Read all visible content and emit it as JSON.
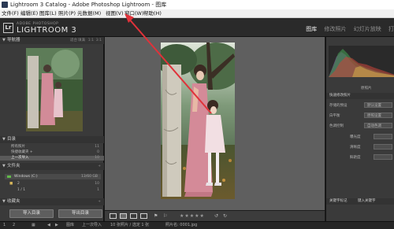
{
  "window": {
    "title": "Lightroom 3 Catalog - Adobe Photoshop Lightroom - 图库"
  },
  "menu": {
    "items": [
      "文件(F)",
      "编辑(E)",
      "图库(L)",
      "照片(P)",
      "元数据(M)",
      "视图(V)",
      "窗口(W)",
      "帮助(H)"
    ]
  },
  "identity": {
    "badge": "Lr",
    "brand_small": "ADOBE PHOTOSHOP",
    "brand_big": "LIGHTROOM 3"
  },
  "modules": {
    "items": [
      "图库",
      "修改照片",
      "幻灯片放映",
      "打"
    ],
    "active_index": 0
  },
  "left_panel": {
    "navigator": {
      "title": "导航器",
      "zoom_options": [
        "适合",
        "填满",
        "1:1",
        "3:1"
      ]
    },
    "catalog": {
      "title": "目录",
      "rows": [
        {
          "label": "所有照片",
          "count": "11"
        },
        {
          "label": "快捷收藏夹 +",
          "count": "0"
        },
        {
          "label": "上一次导入",
          "count": "10"
        }
      ],
      "selected_index": 2
    },
    "folders": {
      "title": "文件夹",
      "drive": {
        "label": "Windows (C:)",
        "info": "13/60 GB"
      },
      "subfolders": [
        {
          "label": "2",
          "count": "10"
        },
        {
          "label": "1 / 1",
          "count": "1"
        }
      ]
    },
    "collections": {
      "title": "收藏夹"
    },
    "buttons": {
      "import": "导入目录",
      "export": "导出目录"
    }
  },
  "toolbar": {
    "stars": "★★★★★"
  },
  "right_panel": {
    "histogram_label": "原照片",
    "quick_develop_title": "快速修改照片",
    "rows": [
      {
        "label": "存储的预设",
        "value": "默认设置"
      },
      {
        "label": "白平衡",
        "value": "原照设置"
      },
      {
        "label": "色调控制",
        "value": "自动色调"
      }
    ],
    "small_labels": [
      "曝光度",
      "清晰度",
      "鲜艳度"
    ],
    "keyword_title": "关键字标记",
    "keyword_value": "键入关键字"
  },
  "filmstrip": {
    "items": [
      "1",
      "2",
      "图库",
      "上一次导入",
      "10 张照片 / 选定 1 张",
      "照片名: 0001.jpg"
    ]
  },
  "colors": {
    "annotation_arrow": "#e0323a",
    "active_module": "#eaeaea",
    "panel_bg": "#3a3a3a"
  }
}
